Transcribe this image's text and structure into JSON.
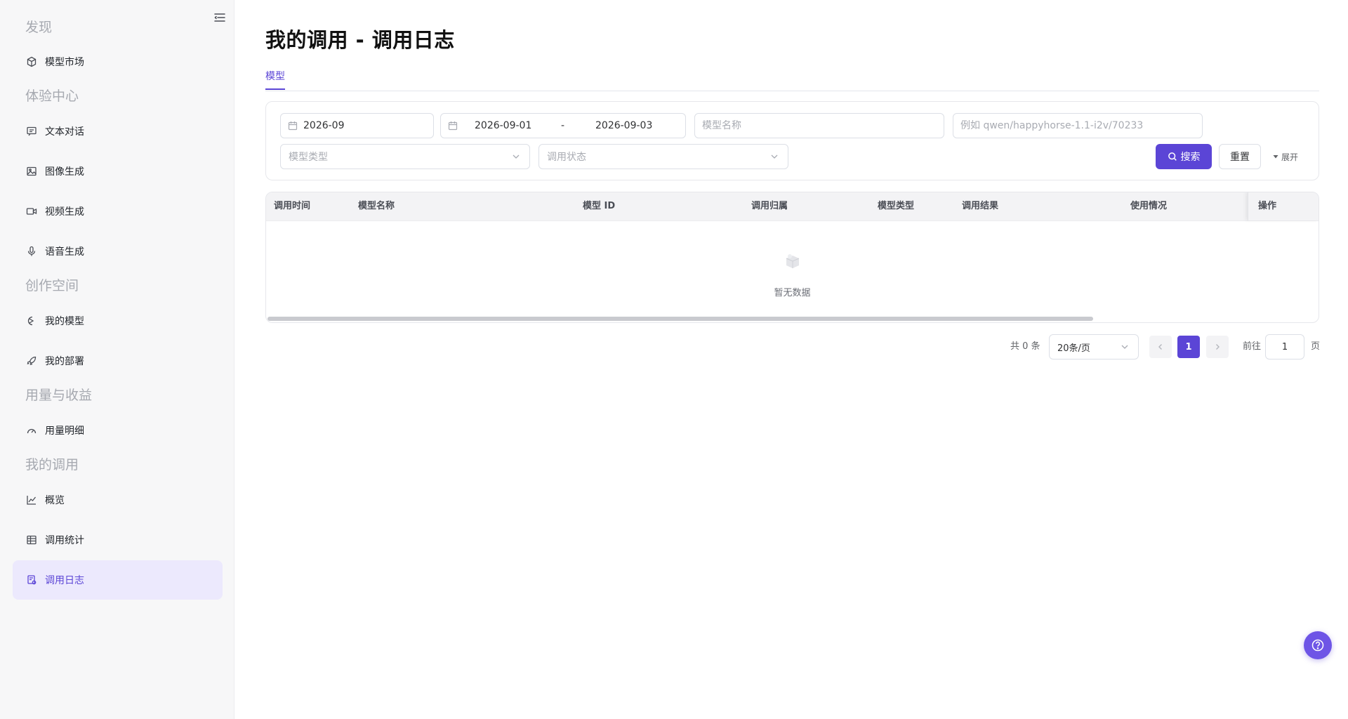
{
  "sidebar": {
    "sections": [
      {
        "title": "发现",
        "items": [
          {
            "label": "模型市场",
            "icon": "cube-icon"
          }
        ]
      },
      {
        "title": "体验中心",
        "items": [
          {
            "label": "文本对话",
            "icon": "chat-icon"
          },
          {
            "label": "图像生成",
            "icon": "image-icon"
          },
          {
            "label": "视频生成",
            "icon": "video-icon"
          },
          {
            "label": "语音生成",
            "icon": "mic-icon"
          }
        ]
      },
      {
        "title": "创作空间",
        "items": [
          {
            "label": "我的模型",
            "icon": "model-icon"
          },
          {
            "label": "我的部署",
            "icon": "rocket-icon"
          }
        ]
      },
      {
        "title": "用量与收益",
        "items": [
          {
            "label": "用量明细",
            "icon": "gauge-icon"
          }
        ]
      },
      {
        "title": "我的调用",
        "items": [
          {
            "label": "概览",
            "icon": "chart-line-icon"
          },
          {
            "label": "调用统计",
            "icon": "table-icon"
          },
          {
            "label": "调用日志",
            "icon": "log-icon"
          }
        ]
      }
    ],
    "active_item": "调用日志"
  },
  "page": {
    "title": "我的调用 - 调用日志"
  },
  "tabs": [
    {
      "label": "模型",
      "active": true
    }
  ],
  "filters": {
    "month_value": "2026-09",
    "range_start": "2026-09-01",
    "range_sep": "-",
    "range_end": "2026-09-03",
    "model_name_placeholder": "模型名称",
    "model_id_placeholder": "例如 qwen/happyhorse-1.1-i2v/70233",
    "model_type_placeholder": "模型类型",
    "call_status_placeholder": "调用状态",
    "search_label": "搜索",
    "reset_label": "重置",
    "expand_label": "展开"
  },
  "table": {
    "columns": [
      "调用时间",
      "模型名称",
      "模型 ID",
      "调用归属",
      "模型类型",
      "调用结果",
      "使用情况",
      "操作"
    ],
    "rows": [],
    "empty_text": "暂无数据"
  },
  "pagination": {
    "total_text": "共 0 条",
    "page_size": "20条/页",
    "current_page": "1",
    "goto_label": "前往",
    "goto_value": "1",
    "page_suffix": "页"
  },
  "colors": {
    "accent": "#5b45d6",
    "active_bg": "#ece9fd"
  }
}
